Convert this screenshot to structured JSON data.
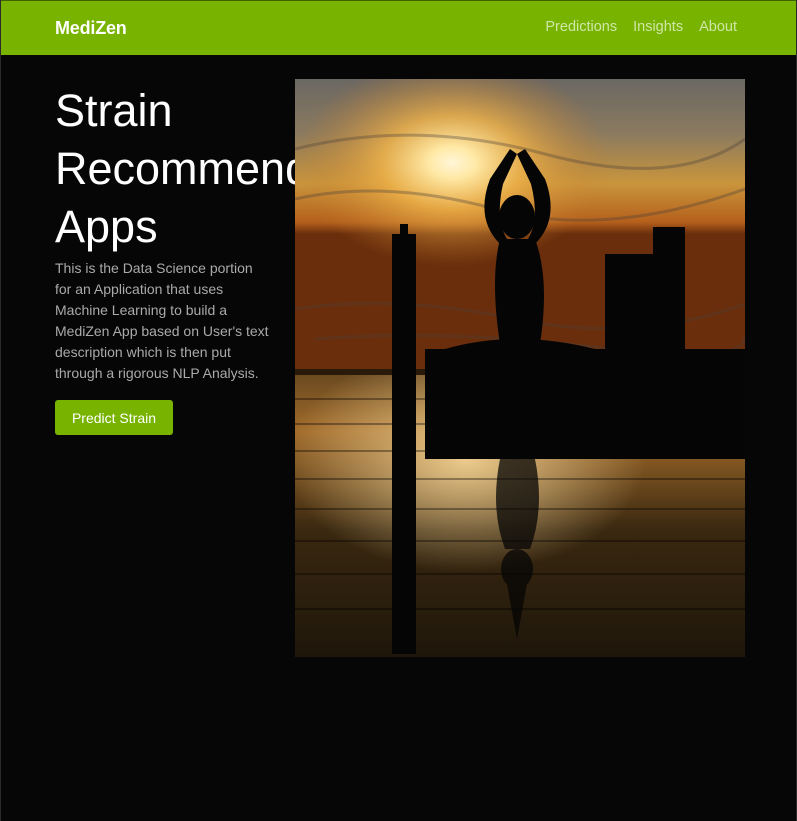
{
  "navbar": {
    "brand": "MediZen",
    "links": [
      "Predictions",
      "Insights",
      "About"
    ]
  },
  "hero": {
    "title_lines": [
      "Strain",
      "Recommendation",
      "Apps"
    ],
    "description": "This is the Data Science portion for an Application that uses Machine Learning to build a MediZen App based on User's text description which is then put through a rigorous NLP Analysis.",
    "cta_label": "Predict Strain"
  },
  "colors": {
    "accent": "#78b300",
    "background": "#060606",
    "text_muted": "#aaaaaa"
  }
}
